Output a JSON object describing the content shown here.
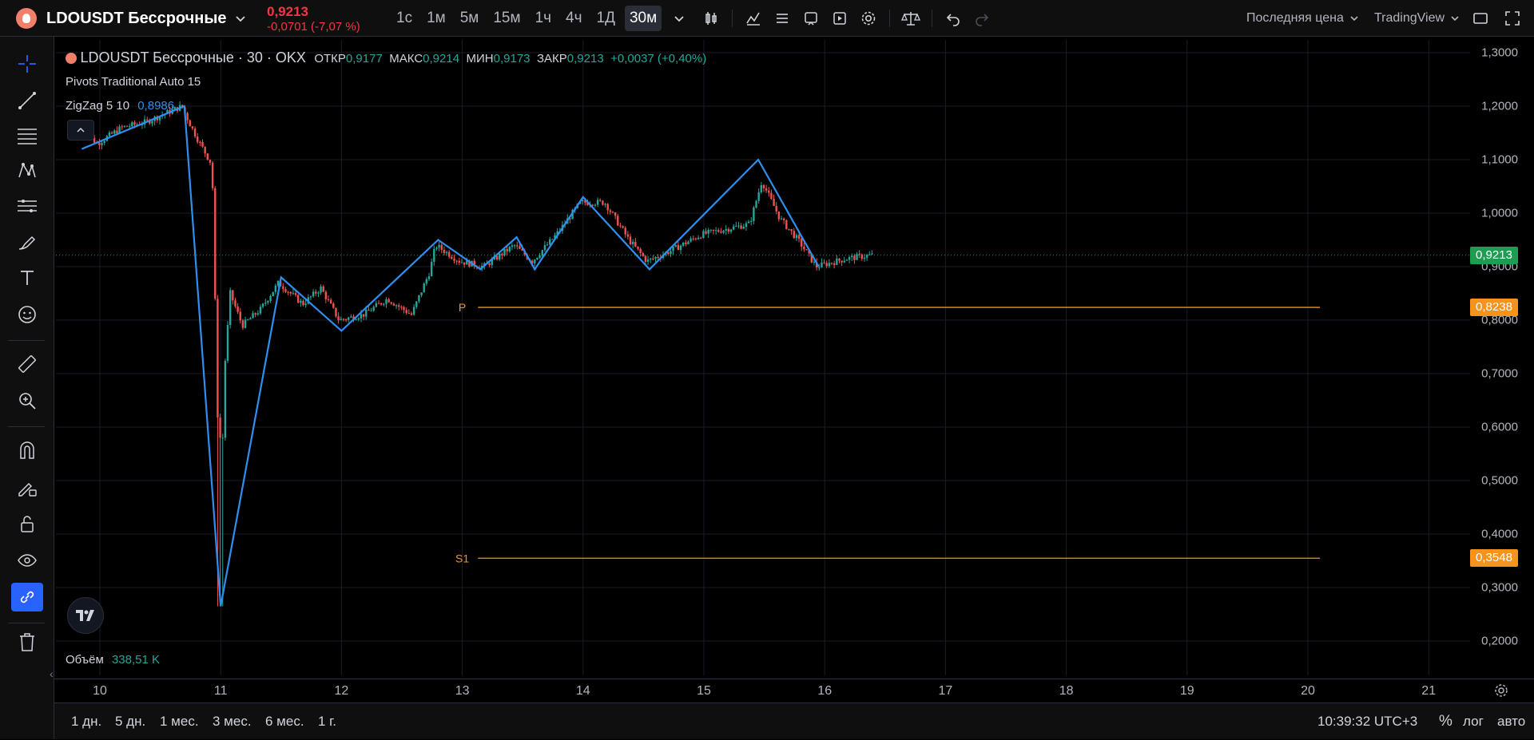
{
  "header": {
    "symbol": "LDOUSDT Бессрочные",
    "price": "0,9213",
    "change": "-0,0701 (-7,07 %)",
    "timeframes": [
      "1с",
      "1м",
      "5м",
      "15м",
      "1ч",
      "4ч",
      "1Д",
      "30м"
    ],
    "active_timeframe": "30м",
    "price_type": "Последняя цена",
    "theme_label": "TradingView"
  },
  "legend": {
    "title": "LDOUSDT Бессрочные · 30 · OKX",
    "open_label": "ОТКР",
    "open": "0,9177",
    "high_label": "МАКС",
    "high": "0,9214",
    "low_label": "МИН",
    "low": "0,9173",
    "close_label": "ЗАКР",
    "close": "0,9213",
    "change": "+0,0037 (+0,40%)",
    "pivots": "Pivots Traditional Auto 15",
    "zigzag_label": "ZigZag 5 10",
    "zigzag_value": "0,8986"
  },
  "volume": {
    "label": "Объём",
    "value": "338,51 K"
  },
  "bottom": {
    "ranges": [
      "1 дн.",
      "5 дн.",
      "1 мес.",
      "3 мес.",
      "6 мес.",
      "1 г."
    ],
    "time": "10:39:32 UTC+3",
    "percent": "%",
    "log": "лог",
    "auto": "авто"
  },
  "colors": {
    "up": "#26a69a",
    "down": "#ef5350",
    "zigzag": "#2f8ff0",
    "pivot": "#f7931a",
    "last": "#1c9d52",
    "header_down": "#f23645"
  },
  "chart_data": {
    "type": "candlestick",
    "title": "LDOUSDT Бессрочные · 30 · OKX",
    "xlabel": "",
    "ylabel": "",
    "x_ticks": [
      "10",
      "11",
      "12",
      "13",
      "14",
      "15",
      "16",
      "17",
      "18",
      "19",
      "20",
      "21"
    ],
    "y_ticks": [
      "1,3000",
      "1,2000",
      "1,1000",
      "1,0000",
      "0,9000",
      "0,8000",
      "0,7000",
      "0,6000",
      "0,5000",
      "0,4000",
      "0,3000",
      "0,2000"
    ],
    "ylim": [
      0.2,
      1.3
    ],
    "last_price": 0.9213,
    "last_price_label": "0,9213",
    "pivots": [
      {
        "name": "P",
        "value": 0.8238,
        "label": "0,8238"
      },
      {
        "name": "S1",
        "value": 0.3548,
        "label": "0,3548"
      }
    ],
    "zigzag": [
      {
        "x": 9.85,
        "y": 1.12
      },
      {
        "x": 10.7,
        "y": 1.2
      },
      {
        "x": 11.0,
        "y": 0.265
      },
      {
        "x": 11.5,
        "y": 0.88
      },
      {
        "x": 12.0,
        "y": 0.78
      },
      {
        "x": 12.8,
        "y": 0.95
      },
      {
        "x": 13.15,
        "y": 0.895
      },
      {
        "x": 13.45,
        "y": 0.955
      },
      {
        "x": 13.6,
        "y": 0.895
      },
      {
        "x": 14.0,
        "y": 1.03
      },
      {
        "x": 14.55,
        "y": 0.895
      },
      {
        "x": 15.45,
        "y": 1.1
      },
      {
        "x": 15.95,
        "y": 0.9
      }
    ],
    "price_path": [
      [
        9.85,
        1.16
      ],
      [
        10.0,
        1.13
      ],
      [
        10.2,
        1.16
      ],
      [
        10.4,
        1.17
      ],
      [
        10.6,
        1.19
      ],
      [
        10.7,
        1.2
      ],
      [
        10.78,
        1.16
      ],
      [
        10.85,
        1.13
      ],
      [
        10.95,
        1.09
      ],
      [
        11.0,
        0.58
      ],
      [
        11.05,
        0.7
      ],
      [
        11.1,
        0.85
      ],
      [
        11.2,
        0.79
      ],
      [
        11.35,
        0.82
      ],
      [
        11.5,
        0.87
      ],
      [
        11.7,
        0.83
      ],
      [
        11.85,
        0.86
      ],
      [
        12.0,
        0.8
      ],
      [
        12.2,
        0.81
      ],
      [
        12.4,
        0.84
      ],
      [
        12.6,
        0.81
      ],
      [
        12.75,
        0.89
      ],
      [
        12.8,
        0.94
      ],
      [
        13.0,
        0.91
      ],
      [
        13.2,
        0.9
      ],
      [
        13.45,
        0.94
      ],
      [
        13.6,
        0.91
      ],
      [
        13.8,
        0.96
      ],
      [
        14.0,
        1.02
      ],
      [
        14.2,
        1.02
      ],
      [
        14.4,
        0.95
      ],
      [
        14.55,
        0.91
      ],
      [
        14.75,
        0.93
      ],
      [
        15.0,
        0.96
      ],
      [
        15.2,
        0.97
      ],
      [
        15.4,
        0.98
      ],
      [
        15.5,
        1.06
      ],
      [
        15.65,
        0.99
      ],
      [
        15.8,
        0.95
      ],
      [
        15.95,
        0.9
      ],
      [
        16.2,
        0.915
      ],
      [
        16.4,
        0.9213
      ]
    ]
  }
}
